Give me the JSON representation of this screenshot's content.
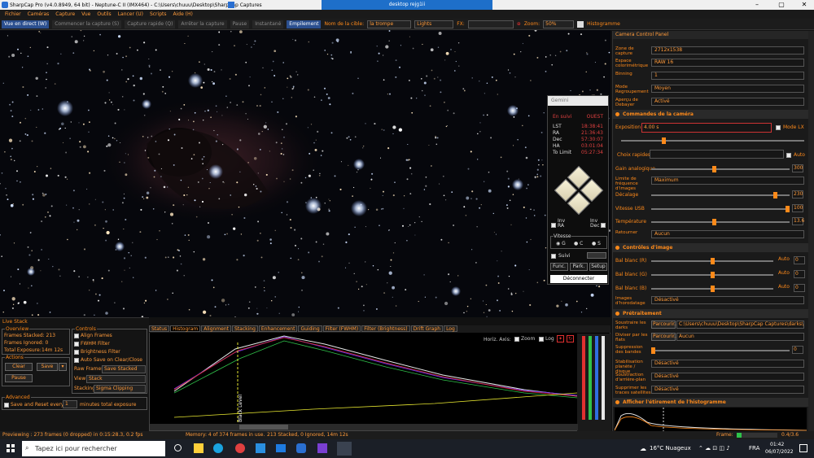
{
  "window": {
    "title": "SharpCap Pro (v4.0.8949, 64 bit) - Neptune-C II (IMX464) - C:\\Users\\chuuu\\Desktop\\SharpCap Captures",
    "dialog_title": "desktop rejg1ii"
  },
  "menu": [
    "Fichier",
    "Caméras",
    "Capture",
    "Vue",
    "Outils",
    "Lancer (U)",
    "Scripts",
    "Aide (H)"
  ],
  "toolbar": {
    "live_view": "Vue en direct (W)",
    "start_capture": "Commencer la capture (S)",
    "quick_capture": "Capture rapide (Q)",
    "stop_capture": "Arrêter la capture",
    "pause": "Pause",
    "snapshot": "Instantané",
    "stacking": "Empilement",
    "target_label": "Nom de la cible:",
    "target_value": "la trompe",
    "frame_type": "Lights",
    "fx_label": "FX:",
    "zoom_label": "Zoom:",
    "zoom_value": "50%",
    "histogram": "Histogramme"
  },
  "gemini": {
    "title": "Gemini",
    "mode_left": "En suivi",
    "mode_right": "OUEST",
    "rows": [
      {
        "k": "LST",
        "v": "18:38:41"
      },
      {
        "k": "RA",
        "v": "21:36:43"
      },
      {
        "k": "Dec",
        "v": "57:30:07"
      },
      {
        "k": "HA",
        "v": "03:01:04"
      },
      {
        "k": "To Limit",
        "v": "05:27:34"
      }
    ],
    "inv_ra": "Inv\nRA",
    "inv_dec": "Inv\nDec",
    "speed_label": "Vitesse",
    "speeds": [
      "G",
      "C",
      "S"
    ],
    "track": "Suivi",
    "func": "Func.",
    "park": "Park.",
    "setup": "Setup",
    "disconnect": "Déconnecter"
  },
  "camera_panel": {
    "title": "Camera Control Panel",
    "props": [
      {
        "label": "Zone de capture",
        "value": "2712x1538"
      },
      {
        "label": "Espace colorimétrique",
        "value": "RAW 16"
      },
      {
        "label": "Binning",
        "value": "1"
      },
      {
        "label": "Mode Regroupement",
        "value": "Moyen"
      },
      {
        "label": "Aperçu de Debayer",
        "value": "Activé"
      }
    ],
    "section_camera": "Commandes de la caméra",
    "exposure_label": "Exposition",
    "exposure_value": "4.00 s",
    "mode_lx": "Mode LX",
    "quick_choice": "Choix rapides",
    "auto": "Auto",
    "gain_label": "Gain analogique",
    "gain_value": "300",
    "frame_limit_label": "Limite de fréquence d'images",
    "frame_limit_value": "Maximum",
    "offset_label": "Décalage",
    "offset_value": "230",
    "usb_label": "Vitesse USB",
    "usb_value": "100",
    "temp_label": "Température",
    "temp_value": "13.6",
    "flip_label": "Retourner",
    "flip_value": "Aucun",
    "section_image": "Contrôles d'image",
    "wb_r": "Bal blanc (R)",
    "wb_g": "Bal blanc (G)",
    "wb_b": "Bal blanc (B)",
    "wb_auto": "Auto",
    "wb_value": "0",
    "timestamp_label": "Images d'horodatage",
    "timestamp_value": "Désactivé",
    "section_pre": "Prétraitement",
    "dark_label": "Soustraire les darks",
    "browse": "Parcourir...",
    "dark_path": "C:\\Users\\chuuu\\Desktop\\SharpCap Captures\\darks\\Ne...",
    "flat_label": "Diviser par les flats",
    "flat_value": "Aucun",
    "banding_label": "Suppression des bandes",
    "banding_value": "0",
    "stab_label": "Stabilisation planète / disque",
    "stab_value": "Désactivé",
    "bg_label": "Soustraction d'arrière-plan",
    "bg_value": "Désactivé",
    "sat_label": "Supprimer les traces satellites",
    "sat_value": "Désactivé",
    "section_histo": "Afficher l'étirement de l'histogramme",
    "frame_label": "Frame:",
    "frame_value": "0.4/3.6"
  },
  "livestack": {
    "title": "Live Stack",
    "overview": "Overview",
    "stacked": "Frames Stacked: 213",
    "ignored": "Frames Ignored: 0",
    "total_label": "Total Exposure:",
    "total_value": "14m 12s",
    "actions": "Actions",
    "clear": "Clear",
    "save": "Save",
    "pause": "Pause",
    "controls": "Controls",
    "align": "Align Frames",
    "fwhm": "FWHM Filter",
    "brightness": "Brightness Filter",
    "autosave": "Auto Save on Clear/Close",
    "raw_label": "Raw Frames",
    "raw_value": "Save Stacked",
    "view_label": "View",
    "view_value": "Stack",
    "stacking_label": "Stacking",
    "stacking_value": "Sigma Clipping",
    "advanced": "Advanced",
    "save_reset_a": "Save and Reset every",
    "save_reset_n": "1",
    "save_reset_b": "minutes total exposure"
  },
  "histo_tabs": [
    "Status",
    "Histogram",
    "Alignment",
    "Stacking",
    "Enhancement",
    "Guiding",
    "Filter (FWHM)",
    "Filter (Brightness)",
    "Drift Graph",
    "Log"
  ],
  "histo": {
    "horiz_axis": "Horiz. Axis:",
    "zoom": "Zoom",
    "log": "Log",
    "black_level": "Black Level"
  },
  "status": {
    "previewing": "Previewing : 273 frames (0 dropped) in 0:15:28.3, 0.2 fps",
    "memory": "Memory: 4 of 374 frames in use.",
    "stacked": "213 Stacked, 0 Ignored, 14m 12s"
  },
  "taskbar": {
    "search": "Tapez ici pour rechercher",
    "weather": "16°C Nuageux",
    "lang": "FRA",
    "time": "01:42",
    "date": "06/07/2022"
  }
}
